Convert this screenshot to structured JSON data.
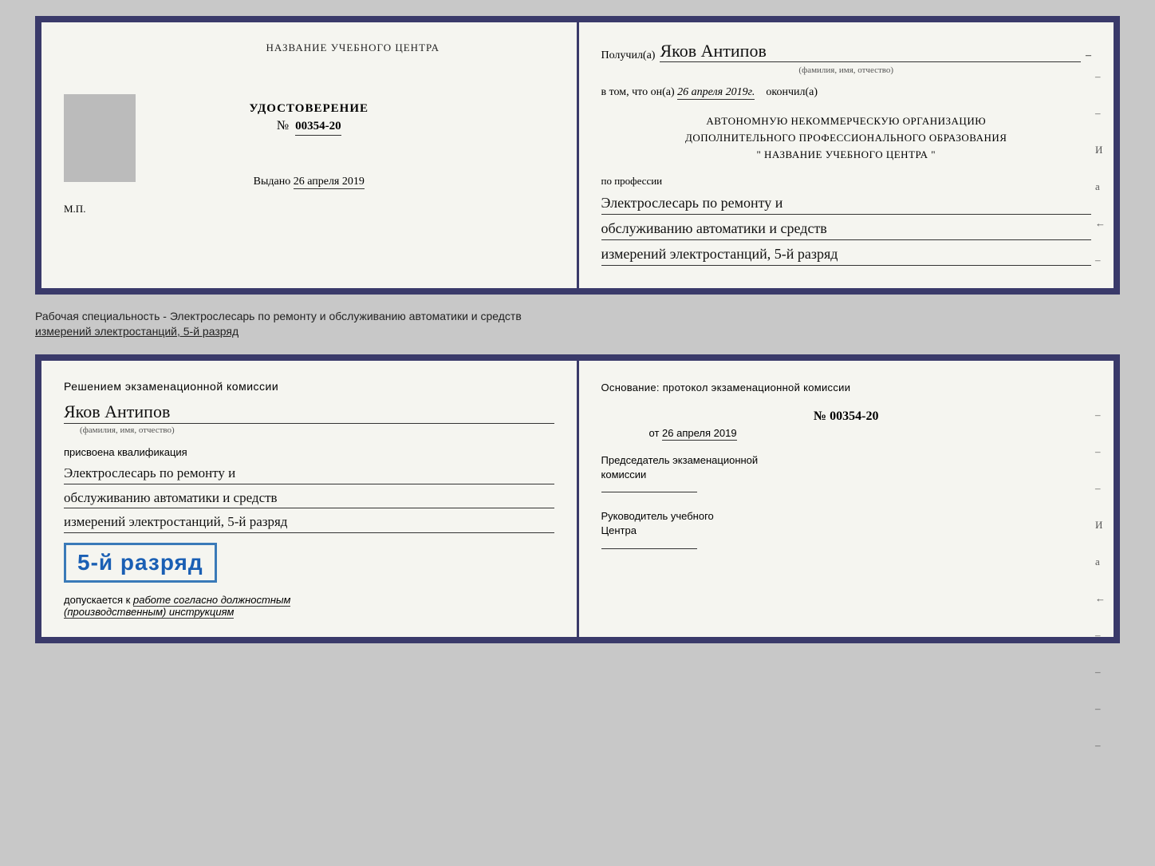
{
  "top_document": {
    "left": {
      "training_center_label": "НАЗВАНИЕ УЧЕБНОГО ЦЕНТРА",
      "photo_placeholder": "фото",
      "udostoverenie_title": "УДОСТОВЕРЕНИЕ",
      "number_prefix": "№",
      "number": "00354-20",
      "vydano_label": "Выдано",
      "vydano_date": "26 апреля 2019",
      "mp_label": "М.П."
    },
    "right": {
      "poluchil_label": "Получил(а)",
      "recipient_name": "Яков Антипов",
      "fio_sub": "(фамилия, имя, отчество)",
      "vtom_label": "в том, что он(а)",
      "vtom_date": "26 апреля 2019г.",
      "okonchil_label": "окончил(а)",
      "org_line1": "АВТОНОМНУЮ НЕКОММЕРЧЕСКУЮ ОРГАНИЗАЦИЮ",
      "org_line2": "ДОПОЛНИТЕЛЬНОГО ПРОФЕССИОНАЛЬНОГО ОБРАЗОВАНИЯ",
      "org_quote": "\"",
      "org_name": "НАЗВАНИЕ УЧЕБНОГО ЦЕНТРА",
      "org_quote2": "\"",
      "po_professii_label": "по профессии",
      "profession_line1": "Электрослесарь по ремонту и",
      "profession_line2": "обслуживанию автоматики и средств",
      "profession_line3": "измерений электростанций, 5-й разряд",
      "side_chars": [
        "–",
        "–",
        "И",
        "а",
        "←",
        "–"
      ]
    }
  },
  "description": {
    "text_line1": "Рабочая специальность - Электрослесарь по ремонту и обслуживанию автоматики и средств",
    "text_line2": "измерений электростанций, 5-й разряд"
  },
  "bottom_document": {
    "left": {
      "resheniem_label": "Решением экзаменационной комиссии",
      "recipient_name": "Яков Антипов",
      "fio_sub": "(фамилия, имя, отчество)",
      "prisvoena_label": "присвоена квалификация",
      "qualification_line1": "Электрослесарь по ремонту и",
      "qualification_line2": "обслуживанию автоматики и средств",
      "qualification_line3": "измерений электростанций, 5-й разряд",
      "razryad_display": "5-й разряд",
      "dopuskaetsya_prefix": "допускается к",
      "dopuskaetsya_italic": "работе согласно должностным",
      "dopuskaetsya_italic2": "(производственным) инструкциям"
    },
    "right": {
      "osnovanie_label": "Основание: протокол экзаменационной комиссии",
      "number_prefix": "№",
      "number": "00354-20",
      "ot_prefix": "от",
      "ot_date": "26 апреля 2019",
      "predsedatel_label": "Председатель экзаменационной",
      "predsedatel_label2": "комиссии",
      "rukovoditel_label": "Руководитель учебного",
      "rukovoditel_label2": "Центра",
      "side_chars": [
        "–",
        "–",
        "–",
        "И",
        "а",
        "←",
        "–",
        "–",
        "–",
        "–"
      ]
    }
  }
}
